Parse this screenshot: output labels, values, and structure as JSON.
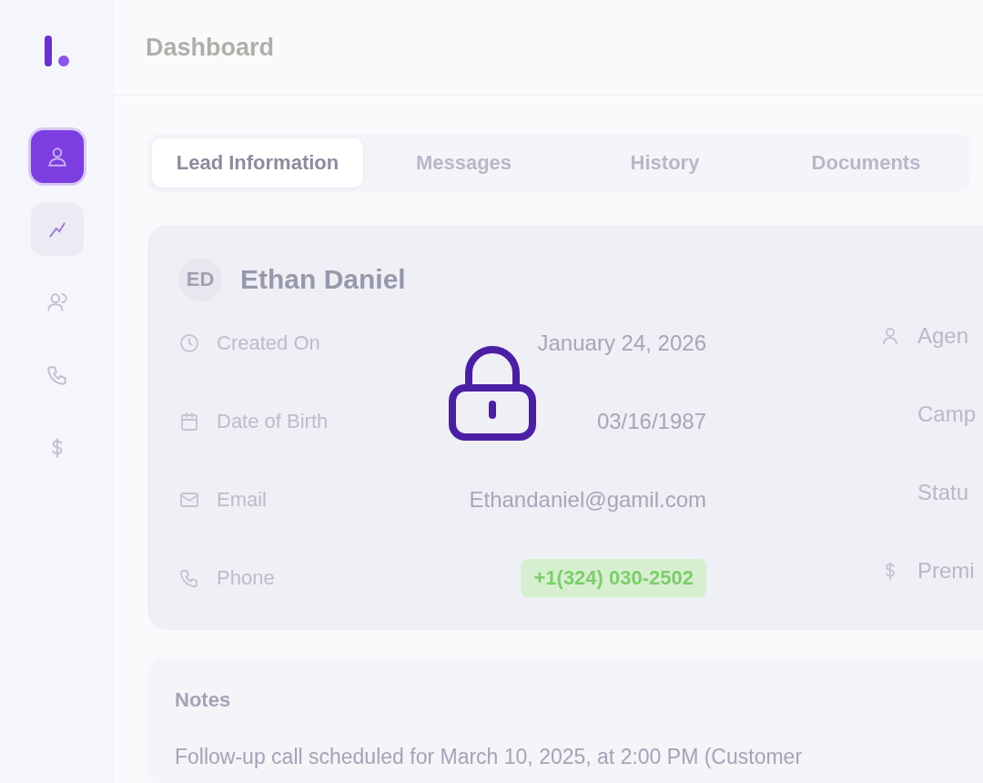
{
  "sidebar": {
    "items": [
      {
        "selected": true,
        "hovered": false
      },
      {
        "selected": false,
        "hovered": true
      },
      {
        "selected": false,
        "hovered": false
      },
      {
        "selected": false,
        "hovered": false
      },
      {
        "selected": false,
        "hovered": false
      }
    ]
  },
  "header": {
    "title": "Dashboard"
  },
  "tabs": [
    {
      "label": "Lead Information",
      "selected": true
    },
    {
      "label": "Messages",
      "selected": false
    },
    {
      "label": "History",
      "selected": false
    },
    {
      "label": "Documents",
      "selected": false
    }
  ],
  "lead": {
    "initials": "ED",
    "name": "Ethan Daniel",
    "fields": [
      {
        "label": "Created On",
        "value": "January 24, 2026",
        "kind": "text"
      },
      {
        "label": "Date of Birth",
        "value": "03/16/1987",
        "kind": "text"
      },
      {
        "label": "Email",
        "value": "Ethandaniel@gamil.com",
        "kind": "text"
      },
      {
        "label": "Phone",
        "value": "+1(324) 030-2502",
        "kind": "pill"
      }
    ],
    "side_fields": [
      {
        "label": "Agen"
      },
      {
        "label": "Camp"
      },
      {
        "label": "Statu"
      },
      {
        "label": "Premi"
      }
    ]
  },
  "notes": {
    "title": "Notes",
    "text": "Follow-up call scheduled for March 10, 2025, at 2:00 PM (Customer"
  },
  "overlay": {
    "locked": true
  }
}
